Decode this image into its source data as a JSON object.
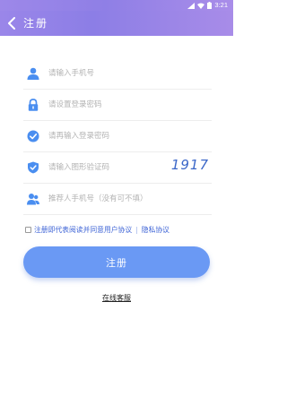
{
  "status_bar": {
    "time": "3:21"
  },
  "app_bar": {
    "title": "注册"
  },
  "form": {
    "phone_placeholder": "请输入手机号",
    "password_placeholder": "请设置登录密码",
    "confirm_placeholder": "请再输入登录密码",
    "captcha_placeholder": "请输入图形验证码",
    "captcha_code": "1917",
    "referrer_placeholder": "推荐人手机号（没有可不填）"
  },
  "agreement": {
    "prefix": "注册即代表阅读并同意用户协议",
    "separator": "|",
    "privacy": "隐私协议"
  },
  "submit_label": "注册",
  "service_link": "在线客服",
  "colors": {
    "accent": "#8f7fe6",
    "button": "#6a99f4",
    "icon": "#4a8ef0",
    "link": "#3d63d6"
  }
}
